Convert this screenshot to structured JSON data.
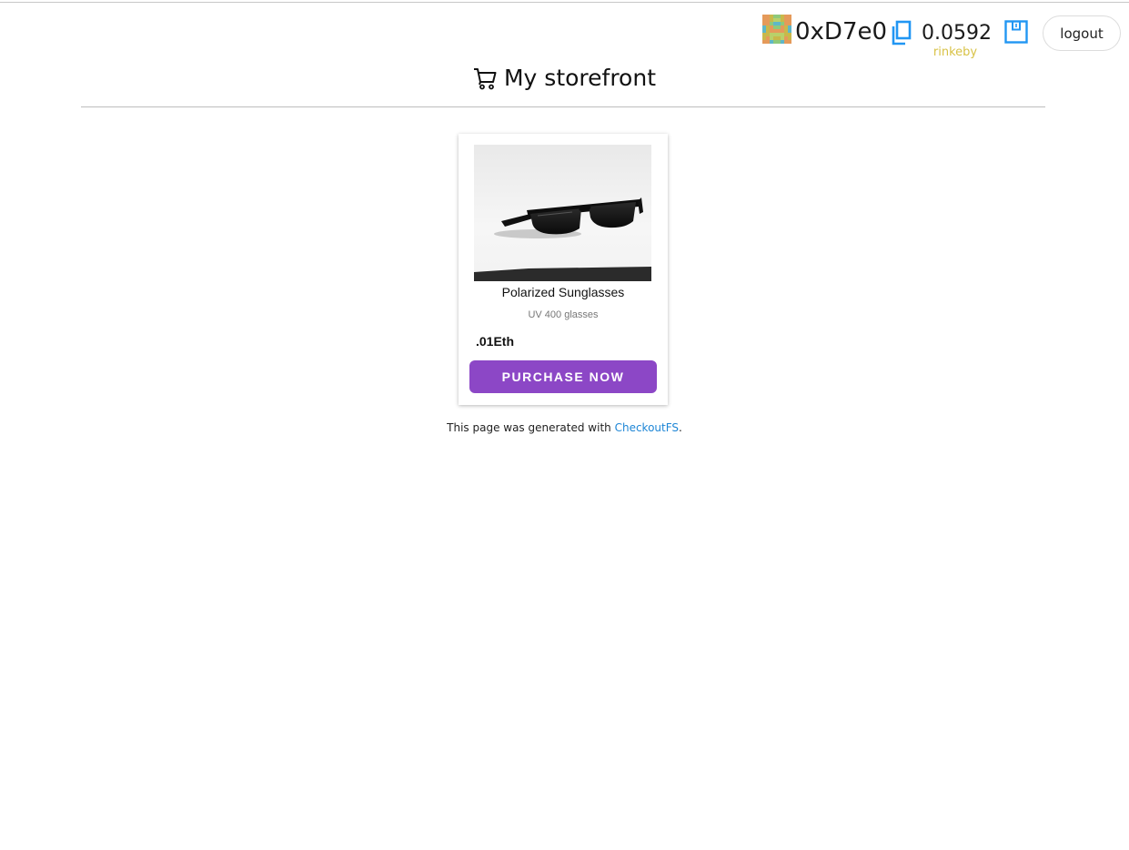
{
  "account": {
    "address": "0xD7e0",
    "balance": "0.0592",
    "network": "rinkeby",
    "logout_label": "logout",
    "icons": [
      "identicon",
      "copy-icon",
      "wallet-icon"
    ]
  },
  "header": {
    "title": "My storefront",
    "icon": "cart-icon"
  },
  "products": [
    {
      "name": "Polarized Sunglasses",
      "description": "UV 400 glasses",
      "price": ".01Eth",
      "button_label": "PURCHASE NOW",
      "image": "sunglasses-photo"
    }
  ],
  "footer": {
    "prefix": "This page was generated with ",
    "link_text": "CheckoutFS",
    "suffix": "."
  },
  "colors": {
    "accent": "#8c47c6",
    "link": "#1e86d6",
    "network": "#d8c246",
    "icon_blue": "#2196f3"
  }
}
